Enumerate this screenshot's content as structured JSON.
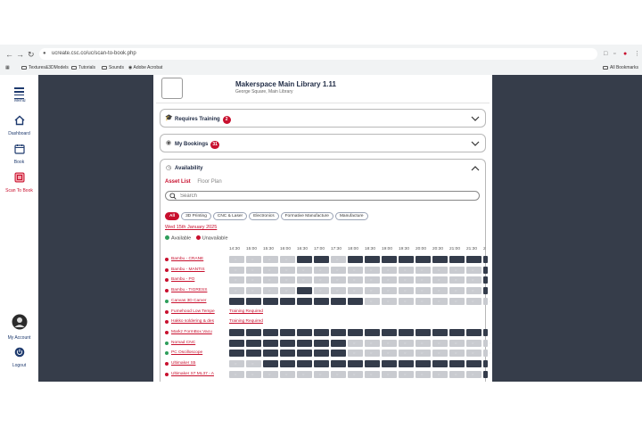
{
  "browser": {
    "url": "ucreate.csc.co/uc/scan-to-book.php",
    "bookmarks": [
      "Textures&3DModels",
      "Tutorials",
      "Sounds",
      "Adobe Acrobat"
    ],
    "all_bookmarks": "All Bookmarks"
  },
  "sidebar": {
    "items": [
      {
        "label": "Menu",
        "icon": "hamburger-icon"
      },
      {
        "label": "Dashboard",
        "icon": "home-icon"
      },
      {
        "label": "Book",
        "icon": "calendar-icon"
      },
      {
        "label": "Scan To Book",
        "icon": "qr-scan-icon"
      },
      {
        "label": "My Account",
        "icon": "avatar-icon"
      },
      {
        "label": "Logout",
        "icon": "power-icon"
      }
    ]
  },
  "location": {
    "title": "Makerspace Main Library 1.11",
    "subtitle": "George Square, Main Library"
  },
  "sections": {
    "requires_training": {
      "label": "Requires Training",
      "count": "2"
    },
    "my_bookings": {
      "label": "My Bookings",
      "count": "31"
    },
    "availability": {
      "label": "Availability"
    }
  },
  "availability": {
    "tabs": {
      "asset_list": "Asset List",
      "floor_plan": "Floor Plan"
    },
    "search_placeholder": "Search",
    "filters": [
      "All",
      "3D Printing",
      "CNC & Laser",
      "Electronics",
      "Formative Manufacture",
      "Manufacture"
    ],
    "date": "Wed 15th January 2025",
    "legend": {
      "available": "Available",
      "unavailable": "Unavailable"
    },
    "colors": {
      "available": "#2e9e5b",
      "unavailable": "#c8102e",
      "free_slot": "#c9cbd0",
      "booked_slot": "#343c4b"
    },
    "times": [
      "14:30",
      "15:00",
      "15:30",
      "16:00",
      "16:30",
      "17:00",
      "17:30",
      "18:00",
      "18:30",
      "19:00",
      "19:30",
      "20:00",
      "20:30",
      "21:00",
      "21:30",
      "2"
    ],
    "assets": [
      {
        "name": "Bambu - CRANE",
        "status": "unavailable",
        "slots": "aaaabbabbbbbbbbb"
      },
      {
        "name": "Bambu - MANTIS",
        "status": "unavailable",
        "slots": "aaaaaaaaaaaaaaab"
      },
      {
        "name": "Bambu - PO",
        "status": "unavailable",
        "slots": "aaaaaaaaaaaaaaab"
      },
      {
        "name": "Bambu - TIGRESS",
        "status": "unavailable",
        "slots": "aaaabaaaaaaaaaab"
      },
      {
        "name": "Canvas 3D Carver",
        "status": "available",
        "slots": "bbbbbbbbaaaaaaaa"
      },
      {
        "name": "Fumehood Low Tempe",
        "status": "unavailable",
        "note": "Training Required"
      },
      {
        "name": "Hakko soldering & des",
        "status": "unavailable",
        "note": "Training Required"
      },
      {
        "name": "Markz FormBox Vacu",
        "status": "unavailable",
        "slots": "bbbbbbbbbbbbbbbb"
      },
      {
        "name": "Nomad CNC",
        "status": "available",
        "slots": "bbbbbbbaaaaaaaaa"
      },
      {
        "name": "PC Oscilloscope",
        "status": "available",
        "slots": "bbbbbbbaaaaaaaaa"
      },
      {
        "name": "Ultimaker S5",
        "status": "unavailable",
        "slots": "aabbbbbbbbbbbbbb"
      },
      {
        "name": "Ultimaker S7 ML37 - A",
        "status": "unavailable",
        "slots": "aaaaaaaaaaaaaaab"
      }
    ]
  }
}
